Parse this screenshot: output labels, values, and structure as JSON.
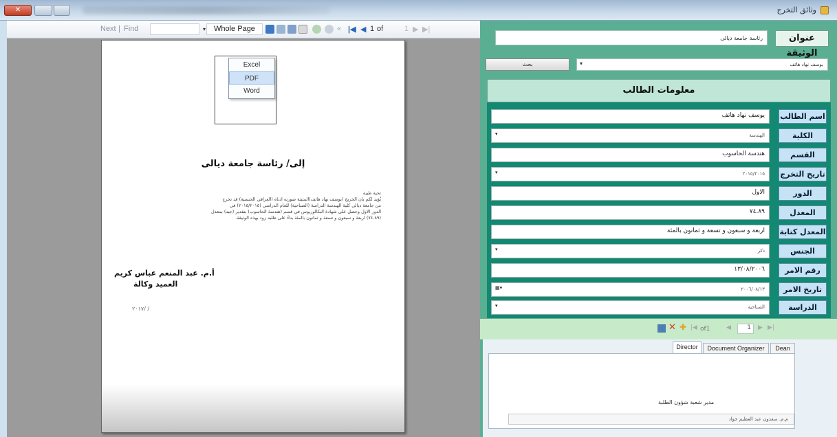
{
  "window": {
    "title": "وثائق التخرج"
  },
  "viewer": {
    "toolbar": {
      "next_label": "Next",
      "find_label": "Find",
      "zoom_value": "Whole Page",
      "page_of_label": "of",
      "page_current": "1"
    },
    "export_menu": {
      "items": [
        "Excel",
        "PDF",
        "Word"
      ],
      "selected_item": "PDF"
    },
    "document": {
      "address": "إلى/ رئاسة جامعة ديالى",
      "greeting": "تحية طيبة",
      "body_lines": [
        "يُؤيد لكم بان الخريج (يوسف نهاد هاتف)المثبتة صورته ادناه (العراقي الجنسية) قد تخرج",
        "من جامعة ديالى كلية الهندسة الدراسة (الصباحية) للعام الدراسي (٢٠١٥/٢٠١٥) في",
        "الدور الاول وحصل على شهادة البكالوريوس في قسم (هندسة الحاسوب) بتقدير (جيد) بمعدل",
        "(٧٤.٨٩) اربعة و سبعون و تسعة و ثمانون بالمئة بناءً على طلبه زود بهذه الوثيقة."
      ],
      "signatory_name": "أ.م. عبد المنعم عباس كريم",
      "signatory_title": "العميد وكالة",
      "page_date": "٢٠١٧/   /"
    }
  },
  "form": {
    "document_title_label": "عنوان الوثيقة",
    "document_title_value": "رئاسة جامعة ديالى",
    "student_select_value": "يوسف نهاد هاتف",
    "search_button": "بحث",
    "student_info_header": "معلومات الطالب",
    "fields": [
      {
        "label": "اسم الطالب",
        "value": "يوسف نهاد هاتف",
        "type": "text"
      },
      {
        "label": "الكلية",
        "value": "الهندسة",
        "type": "select"
      },
      {
        "label": "القسم",
        "value": "هندسة الحاسوب",
        "type": "text"
      },
      {
        "label": "تاريخ التخرج",
        "value": "٢٠١٥/٢٠١٥",
        "type": "select"
      },
      {
        "label": "الدور",
        "value": "الاول",
        "type": "text"
      },
      {
        "label": "المعدل",
        "value": "٧٤.٨٩",
        "type": "text"
      },
      {
        "label": "المعدل كتابة",
        "value": "اربعة و سبعون و تسعة و ثمانون بالمئة",
        "type": "text"
      },
      {
        "label": "الجنس",
        "value": "ذكر",
        "type": "select"
      },
      {
        "label": "رقم الامر",
        "value": "١٣/٠٨/٢٠٠٦",
        "type": "text"
      },
      {
        "label": "تاريخ الامر",
        "value": "٢٠٠٦/٠٨/١٣",
        "type": "select"
      },
      {
        "label": "الدراسة",
        "value": "الصباحية",
        "type": "select"
      }
    ],
    "navigator": {
      "of_label": "of1",
      "position": "1"
    },
    "signer_tabs": [
      {
        "label": "Director"
      },
      {
        "label": "Document Organizer"
      },
      {
        "label": "Dean"
      }
    ],
    "signer_title": "مدير شعبة شؤون الطلبة",
    "signer_name": "م.م. سعدون عبد العظيم جواد"
  }
}
